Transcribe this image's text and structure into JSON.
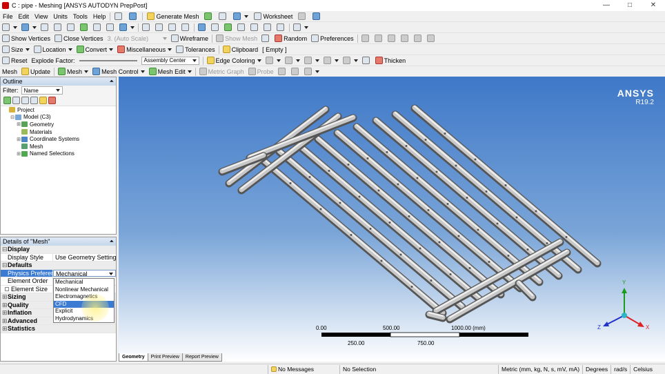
{
  "window": {
    "title": "C : pipe - Meshing [ANSYS AUTODYN PrepPost]"
  },
  "menubar": [
    "File",
    "Edit",
    "View",
    "Units",
    "Tools",
    "Help"
  ],
  "toolbar1": {
    "generate_mesh": "Generate Mesh",
    "worksheet": "Worksheet"
  },
  "toolbar3": {
    "show_vertices": "Show Vertices",
    "close_vertices": "Close Vertices",
    "auto_scale": "3. (Auto Scale)",
    "wireframe": "Wireframe",
    "show_mesh": "Show Mesh",
    "random": "Random",
    "preferences": "Preferences"
  },
  "toolbar4": {
    "size": "Size",
    "location": "Location",
    "convert": "Convert",
    "miscellaneous": "Miscellaneous",
    "tolerances": "Tolerances",
    "clipboard": "Clipboard",
    "clipboard_value": "[ Empty ]"
  },
  "toolbar5": {
    "reset": "Reset",
    "explode_factor": "Explode Factor:",
    "assembly_center": "Assembly Center",
    "edge_coloring": "Edge Coloring",
    "thicken": "Thicken"
  },
  "toolbar6": {
    "mesh_label": "Mesh",
    "update": "Update",
    "mesh": "Mesh",
    "mesh_control": "Mesh Control",
    "mesh_edit": "Mesh Edit",
    "metric_graph": "Metric Graph",
    "probe": "Probe"
  },
  "outline": {
    "title": "Outline",
    "filter_label": "Filter:",
    "filter_value": "Name",
    "nodes": [
      {
        "label": "Project",
        "level": 0,
        "expander": "",
        "color": "#d8b23a"
      },
      {
        "label": "Model (C3)",
        "level": 1,
        "expander": "⊟",
        "color": "#7aa7d9"
      },
      {
        "label": "Geometry",
        "level": 2,
        "expander": "⊞",
        "color": "#5aa25a"
      },
      {
        "label": "Materials",
        "level": 2,
        "expander": "",
        "color": "#9bbb5a"
      },
      {
        "label": "Coordinate Systems",
        "level": 2,
        "expander": "⊞",
        "color": "#4c86c6"
      },
      {
        "label": "Mesh",
        "level": 2,
        "expander": "",
        "color": "#58a070"
      },
      {
        "label": "Named Selections",
        "level": 2,
        "expander": "⊞",
        "color": "#52a850"
      }
    ]
  },
  "details": {
    "title": "Details of \"Mesh\"",
    "display": "Display",
    "display_style_k": "Display Style",
    "display_style_v": "Use Geometry Setting",
    "defaults": "Defaults",
    "physics_k": "Physics Preference",
    "physics_v": "Mechanical",
    "element_order_k": "Element Order",
    "element_size_k": "Element Size",
    "groups": [
      "Sizing",
      "Quality",
      "Inflation",
      "Advanced",
      "Statistics"
    ],
    "dropdown_options": [
      "Mechanical",
      "Nonlinear Mechanical",
      "Electromagnetics",
      "CFD",
      "Explicit",
      "Hydrodynamics"
    ],
    "highlighted": "CFD"
  },
  "viewport": {
    "brand": "ANSYS",
    "version": "R19.2",
    "scale_top": [
      "0.00",
      "500.00",
      "1000.00 (mm)"
    ],
    "scale_bottom": [
      "250.00",
      "750.00"
    ],
    "axes": {
      "x": "X",
      "y": "Y",
      "z": "Z"
    }
  },
  "bottom_tabs": [
    "Geometry",
    "Print Preview",
    "Report Preview"
  ],
  "status": {
    "messages": "No Messages",
    "selection": "No Selection",
    "units": "Metric (mm, kg, N, s, mV, mA)",
    "angle": "Degrees",
    "rate": "rad/s",
    "temp": "Celsius"
  }
}
